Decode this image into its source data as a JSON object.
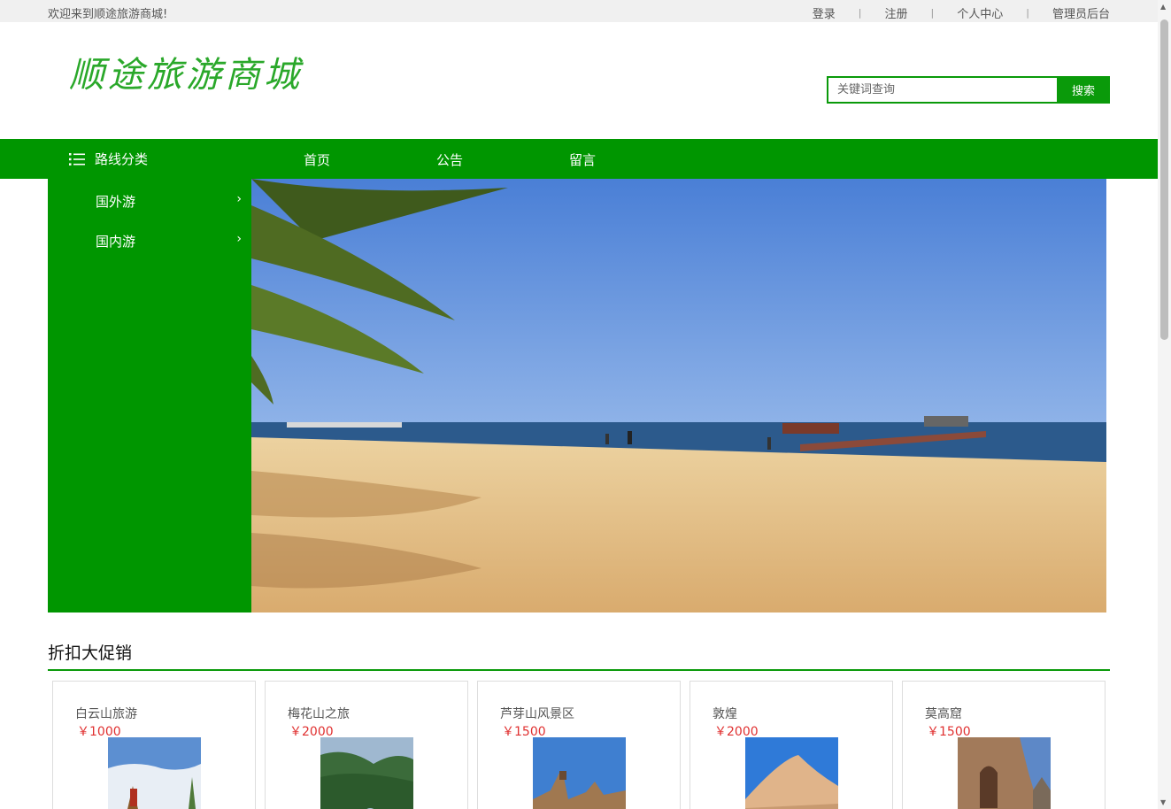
{
  "topbar": {
    "welcome": "欢迎来到顺途旅游商城!",
    "links": [
      "登录",
      "注册",
      "个人中心",
      "管理员后台"
    ]
  },
  "header": {
    "logo": "顺途旅游商城",
    "search_placeholder": "关键词查询",
    "search_button": "搜索"
  },
  "nav": {
    "category_label": "路线分类",
    "items": [
      "首页",
      "公告",
      "留言"
    ]
  },
  "sidebar": {
    "items": [
      "国外游",
      "国内游"
    ]
  },
  "promo": {
    "title": "折扣大促销",
    "products": [
      {
        "name": "白云山旅游",
        "price": "￥1000"
      },
      {
        "name": "梅花山之旅",
        "price": "￥2000"
      },
      {
        "name": "芦芽山风景区",
        "price": "￥1500"
      },
      {
        "name": "敦煌",
        "price": "￥2000"
      },
      {
        "name": "莫高窟",
        "price": "￥1500"
      }
    ]
  },
  "colors": {
    "brand_green": "#009600",
    "price_red": "#e03030",
    "logo_green": "#2aa82a"
  }
}
